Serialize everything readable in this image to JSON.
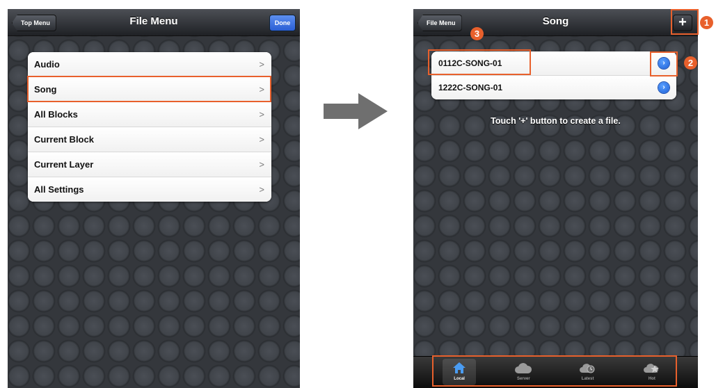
{
  "left_screen": {
    "back_label": "Top Menu",
    "title": "File Menu",
    "done_label": "Done",
    "menu_items": [
      "Audio",
      "Song",
      "All Blocks",
      "Current Block",
      "Current Layer",
      "All Settings"
    ],
    "chevron": ">"
  },
  "right_screen": {
    "back_label": "File Menu",
    "title": "Song",
    "add_label": "+",
    "files": [
      "0112C-SONG-01",
      "1222C-SONG-01"
    ],
    "hint": "Touch '+' button to create a file.",
    "tabs": [
      {
        "label": "Local",
        "icon": "home-icon"
      },
      {
        "label": "Server",
        "icon": "cloud-icon"
      },
      {
        "label": "Latest",
        "icon": "cloud-clock-icon"
      },
      {
        "label": "Hot",
        "icon": "cloud-star-icon"
      }
    ]
  },
  "callouts": [
    "1",
    "2",
    "3"
  ],
  "colors": {
    "highlight": "#e8602c",
    "accent_blue": "#2a5ed4",
    "arrow": "#6f6f6f"
  }
}
